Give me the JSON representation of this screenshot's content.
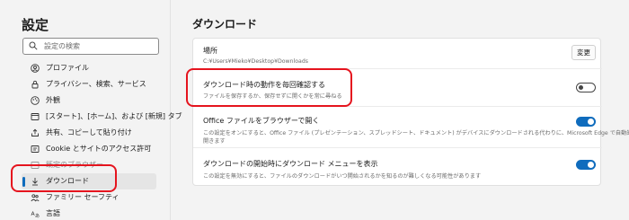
{
  "sidebar": {
    "title": "設定",
    "search_placeholder": "設定の検索",
    "items": [
      {
        "label": "プロファイル",
        "icon": "profile-icon"
      },
      {
        "label": "プライバシー、検索、サービス",
        "icon": "lock-icon"
      },
      {
        "label": "外観",
        "icon": "appearance-icon"
      },
      {
        "label": "[スタート]、[ホーム]、および [新規] タブ",
        "icon": "start-page-icon"
      },
      {
        "label": "共有、コピーして貼り付け",
        "icon": "share-icon"
      },
      {
        "label": "Cookie とサイトのアクセス許可",
        "icon": "site-permissions-icon"
      },
      {
        "label": "既定のブラウザー",
        "icon": "default-browser-icon"
      },
      {
        "label": "ダウンロード",
        "icon": "download-icon"
      },
      {
        "label": "ファミリー セーフティ",
        "icon": "family-icon"
      },
      {
        "label": "言語",
        "icon": "language-icon"
      }
    ]
  },
  "main": {
    "title": "ダウンロード",
    "location": {
      "title": "場所",
      "path": "C:¥Users¥Mieko¥Desktop¥Downloads",
      "change_button": "変更"
    },
    "ask": {
      "title": "ダウンロード時の動作を毎回確認する",
      "description": "ファイルを保存するか、保存せずに開くかを常に尋ねる",
      "enabled": false
    },
    "office": {
      "title": "Office ファイルをブラウザーで開く",
      "description_1": "この設定をオンにすると、Office ファイル (プレゼンテーション、スプレッドシート、ドキュメント) がデバイスにダウンロードされる代わりに、Microsoft Edge で自動的に",
      "description_2": "開きます",
      "enabled": true
    },
    "menu": {
      "title": "ダウンロードの開始時にダウンロード メニューを表示",
      "description": "この設定を無効にすると、ファイルのダウンロードがいつ開始されるかを知るのが難しくなる可能性があります",
      "enabled": true
    }
  },
  "colors": {
    "accent": "#0f6cbd",
    "annotation": "#e5141e"
  }
}
